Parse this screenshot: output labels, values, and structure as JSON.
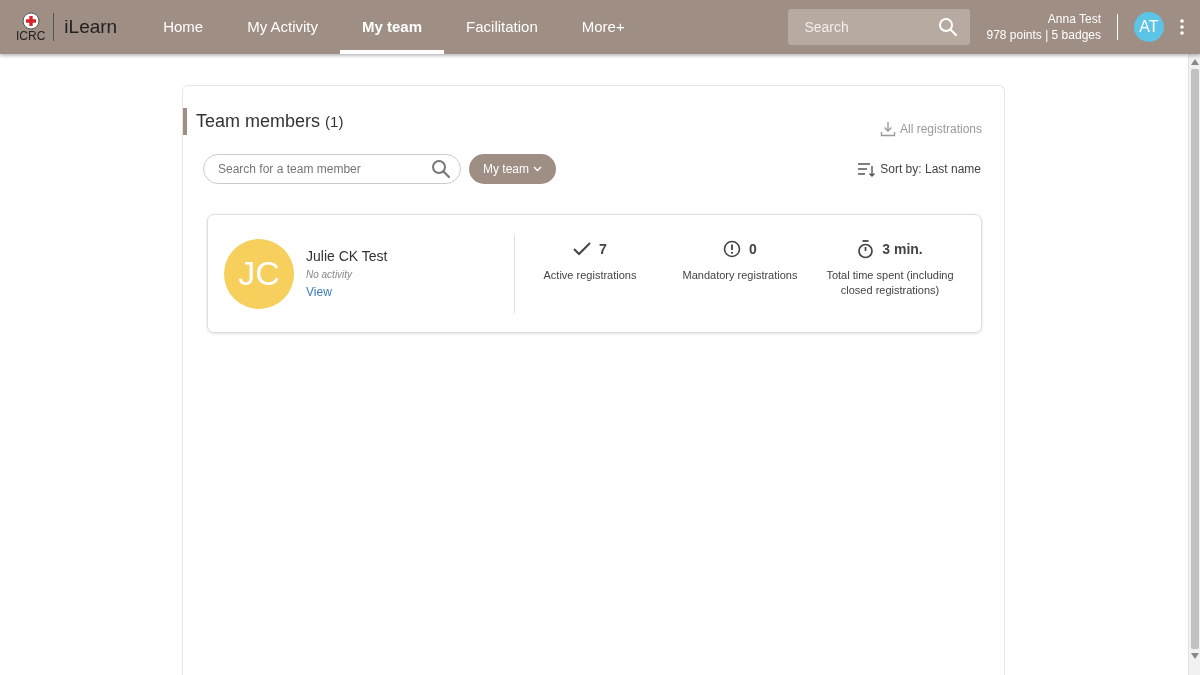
{
  "header": {
    "logo_text": "ICRC",
    "app_name": "iLearn",
    "nav": [
      {
        "label": "Home",
        "selected": false
      },
      {
        "label": "My Activity",
        "selected": false
      },
      {
        "label": "My team",
        "selected": true
      },
      {
        "label": "Facilitation",
        "selected": false
      },
      {
        "label": "More+",
        "selected": false
      }
    ],
    "search": {
      "placeholder": "Search"
    },
    "user": {
      "name": "Anna Test",
      "stats": "978 points | 5 badges",
      "initials": "AT"
    }
  },
  "panel": {
    "title": "Team members",
    "count": "(1)",
    "export": "All registrations",
    "search": {
      "placeholder": "Search for a team member"
    },
    "filter": "My team",
    "sort": "Sort by: Last name",
    "members": [
      {
        "initials": "JC",
        "name": "Julie CK Test",
        "activity": "No activity",
        "link": "View",
        "stats": [
          {
            "kind": "check",
            "value": "7",
            "label": "Active registrations"
          },
          {
            "kind": "alert",
            "value": "0",
            "label": "Mandatory registrations"
          },
          {
            "kind": "timer",
            "value": "3 min.",
            "label": "Total time spent (including closed registrations)"
          }
        ]
      }
    ]
  }
}
